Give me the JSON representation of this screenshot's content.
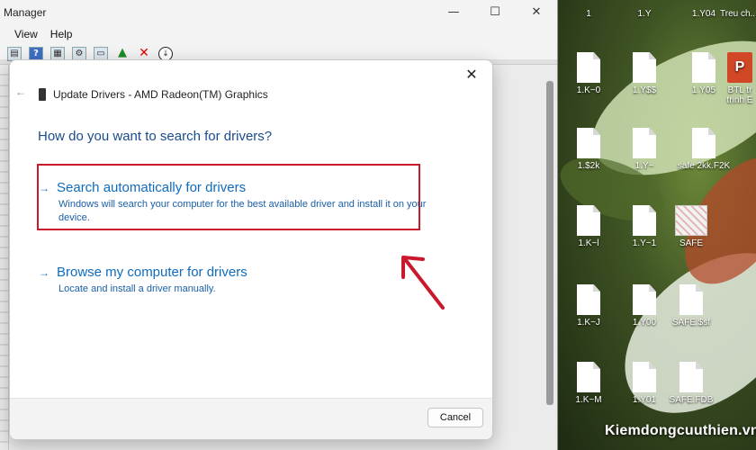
{
  "window": {
    "title": "Manager",
    "minimize": "—",
    "maximize": "☐",
    "close": "✕",
    "menu": [
      "View",
      "Help"
    ]
  },
  "dialog": {
    "close": "✕",
    "back": "←",
    "device_title": "Update Drivers - AMD Radeon(TM) Graphics",
    "question": "How do you want to search for drivers?",
    "options": [
      {
        "arrow": "→",
        "title": "Search automatically for drivers",
        "desc": "Windows will search your computer for the best available driver and install it on your device."
      },
      {
        "arrow": "→",
        "title": "Browse my computer for drivers",
        "desc": "Locate and install a driver manually."
      }
    ],
    "cancel_label": "Cancel"
  },
  "desktop": {
    "icons": [
      {
        "label": "1",
        "kind": "file"
      },
      {
        "label": "1.Y",
        "kind": "file"
      },
      {
        "label": "1.Y04",
        "kind": "file"
      },
      {
        "label": "Treu ch...",
        "kind": "file"
      },
      {
        "label": "1.K~0",
        "kind": "file"
      },
      {
        "label": "1.Y$$",
        "kind": "file"
      },
      {
        "label": "1.Y05",
        "kind": "file"
      },
      {
        "label": "BTL tr trinh E",
        "kind": "ppt"
      },
      {
        "label": "1.$2k",
        "kind": "file"
      },
      {
        "label": "1.Y~",
        "kind": "file"
      },
      {
        "label": "safe 2kk.F2K",
        "kind": "file"
      },
      {
        "label": "1.K~l",
        "kind": "file"
      },
      {
        "label": "1.Y~1",
        "kind": "file"
      },
      {
        "label": "SAFE",
        "kind": "thumb"
      },
      {
        "label": "1.K~J",
        "kind": "file"
      },
      {
        "label": "1.Y00",
        "kind": "file"
      },
      {
        "label": "SAFE.$sf",
        "kind": "file"
      },
      {
        "label": "1.K~M",
        "kind": "file"
      },
      {
        "label": "1.Y01",
        "kind": "file"
      },
      {
        "label": "SAFE.FDB",
        "kind": "file"
      }
    ],
    "ppt_letter": "P"
  },
  "watermark": "Kiemdongcuuthien.vn",
  "colors": {
    "highlight": "#c8192d",
    "link": "#0f6cbd",
    "annotation_arrow": "#c8192d"
  }
}
